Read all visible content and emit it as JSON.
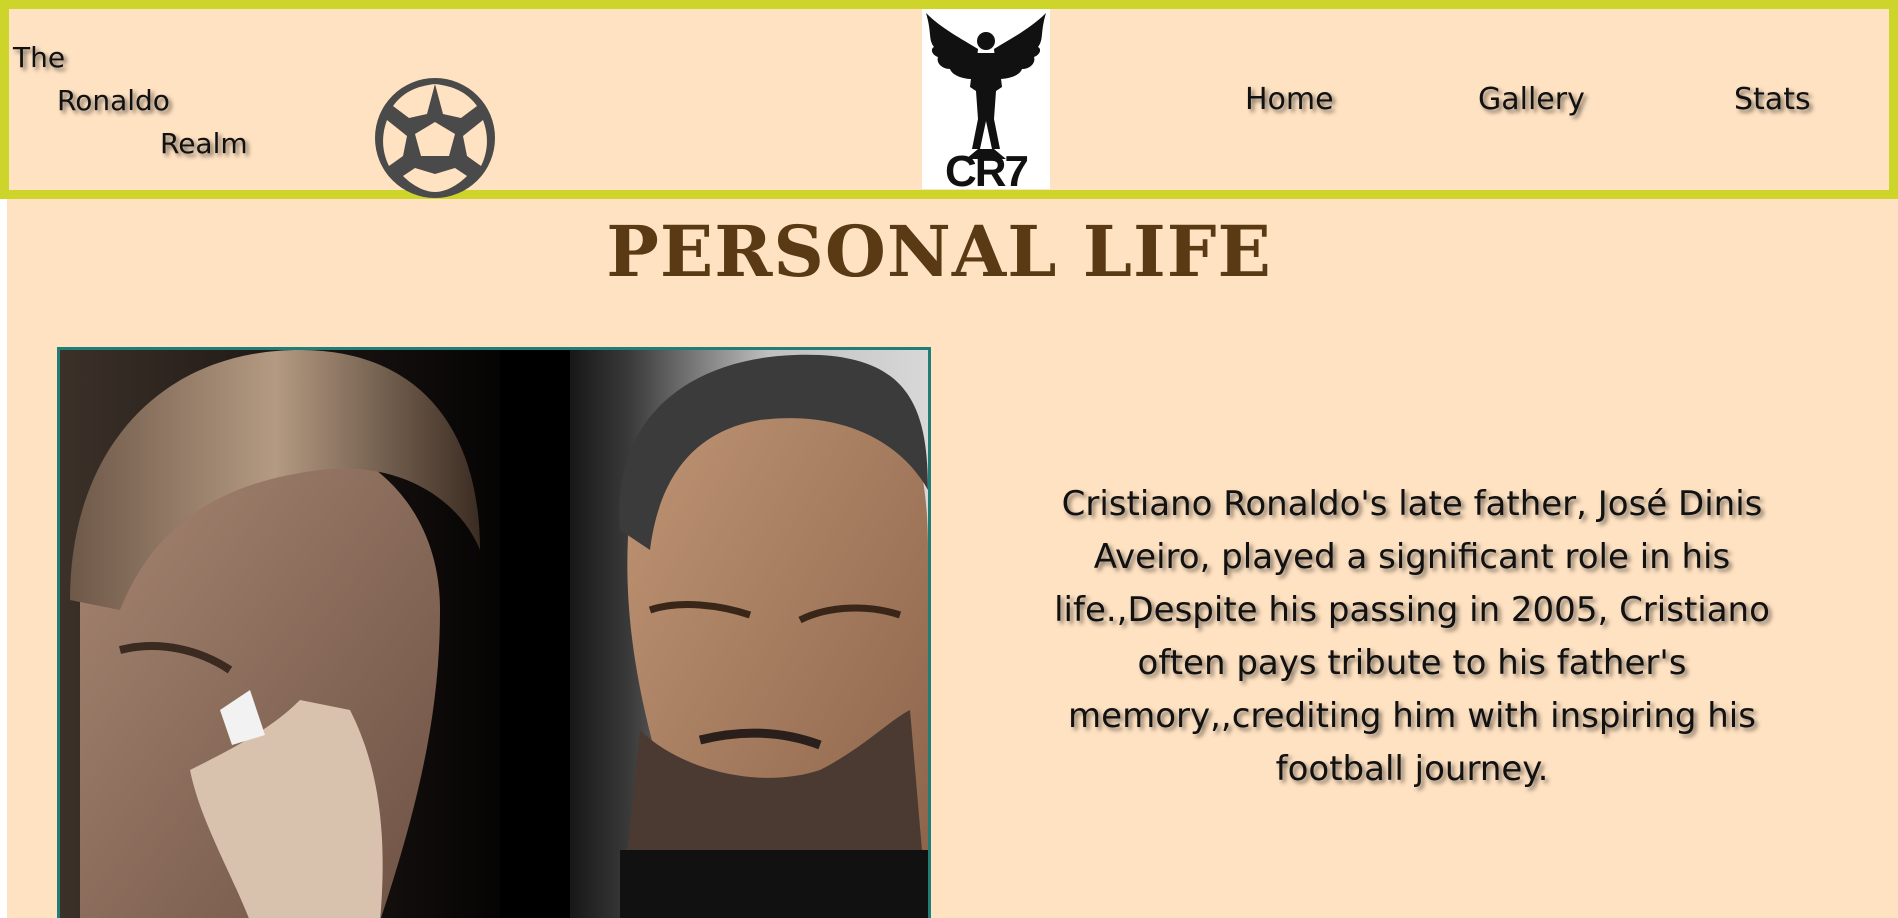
{
  "brand": {
    "line1": "The",
    "line2": "Ronaldo",
    "line3": "Realm"
  },
  "header": {
    "logo_text": "CR7",
    "ball_icon": "soccer-ball-icon",
    "logo_icon": "winged-player-icon"
  },
  "nav": {
    "items": [
      {
        "label": "Home"
      },
      {
        "label": "Gallery"
      },
      {
        "label": "Stats"
      }
    ]
  },
  "main": {
    "title": "PERSONAL LIFE",
    "paragraph": "Cristiano Ronaldo's late father, José Dinis Aveiro, played a significant role in his life.,Despite his passing in 2005, Cristiano often pays tribute to his father's memory,,crediting him with inspiring his football journey."
  },
  "colors": {
    "background": "#ffe2c2",
    "header_border": "#cdd42a",
    "title": "#5a3a14",
    "photo_border": "#1f7f78",
    "ball": "#4a4a4a"
  }
}
